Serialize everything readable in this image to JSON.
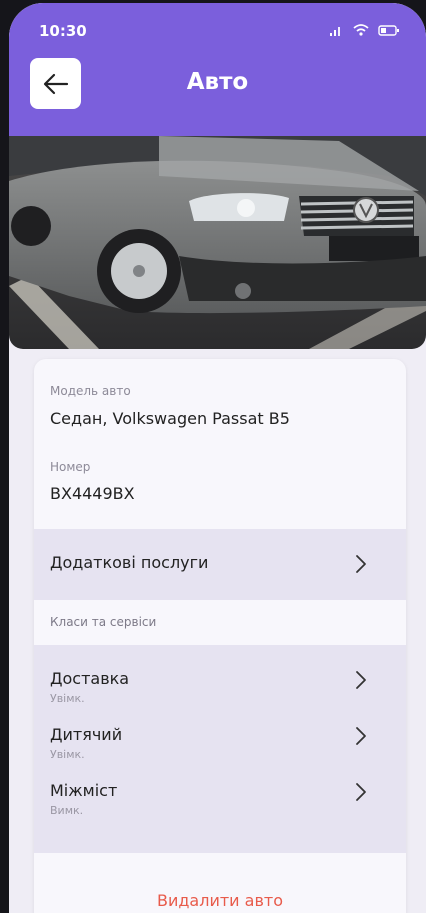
{
  "status_bar": {
    "time": "10:30"
  },
  "header": {
    "title": "Авто"
  },
  "photo": {
    "alt": "car photo"
  },
  "car": {
    "model_label": "Модель авто",
    "model_value": "Седан, Volkswagen Passat B5",
    "number_label": "Номер",
    "number_value": "ВХ4449ВХ"
  },
  "extra_services": {
    "label": "Додаткові послуги"
  },
  "classes_section": {
    "label": "Класи та сервіси"
  },
  "services": [
    {
      "title": "Доставка",
      "status": "Увімк."
    },
    {
      "title": "Дитячий",
      "status": "Увімк."
    },
    {
      "title": "Міжміст",
      "status": "Вимк."
    }
  ],
  "delete_action": {
    "label": "Видалити авто"
  },
  "colors": {
    "accent": "#7b5fdc",
    "danger": "#e85b4b",
    "band": "#e6e3f1"
  }
}
